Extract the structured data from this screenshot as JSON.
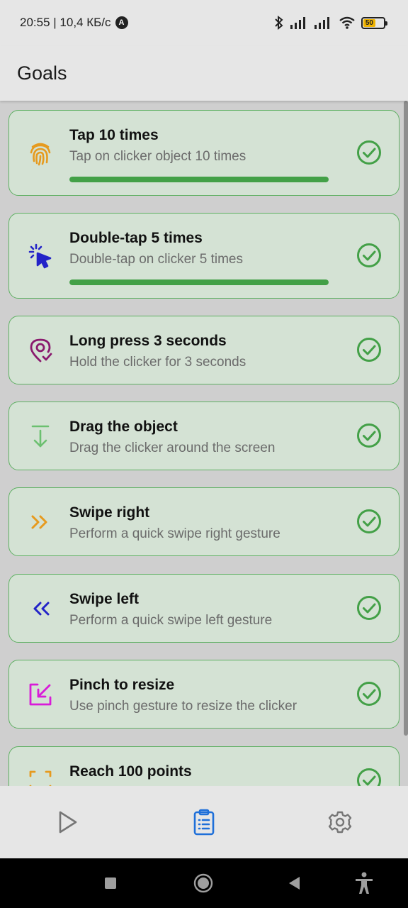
{
  "status": {
    "time_speed": "20:55 | 10,4 КБ/с",
    "battery_level": "50"
  },
  "app": {
    "title": "Goals"
  },
  "goals": [
    {
      "title": "Tap 10 times",
      "description": "Tap on clicker object 10 times",
      "progress": 1.0,
      "icon": "fingerprint-icon",
      "color": "#e69a1e"
    },
    {
      "title": "Double-tap 5 times",
      "description": "Double-tap on clicker 5 times",
      "progress": 1.0,
      "icon": "cursor-click-icon",
      "color": "#2323c8"
    },
    {
      "title": "Long press 3 seconds",
      "description": "Hold the clicker for 3 seconds",
      "icon": "location-pin-check-icon",
      "color": "#8a1a6e"
    },
    {
      "title": "Drag the object",
      "description": "Drag the clicker around the screen",
      "icon": "arrow-down-to-line-icon",
      "color": "#6cc070"
    },
    {
      "title": "Swipe right",
      "description": "Perform a quick swipe right gesture",
      "icon": "double-chevron-right-icon",
      "color": "#e69a1e"
    },
    {
      "title": "Swipe left",
      "description": "Perform a quick swipe left gesture",
      "icon": "double-chevron-left-icon",
      "color": "#2323c8"
    },
    {
      "title": "Pinch to resize",
      "description": "Use pinch gesture to resize the clicker",
      "icon": "resize-icon",
      "color": "#d81bd8"
    },
    {
      "title": "Reach 100 points",
      "description": "",
      "icon": "points-icon",
      "color": "#e69a1e"
    }
  ],
  "colors": {
    "check": "#43a047",
    "accent_nav": "#1e6fd9",
    "card_border": "#5fb063"
  },
  "nav": [
    {
      "icon": "play-icon",
      "active": false
    },
    {
      "icon": "clipboard-list-icon",
      "active": true
    },
    {
      "icon": "gear-icon",
      "active": false
    }
  ]
}
